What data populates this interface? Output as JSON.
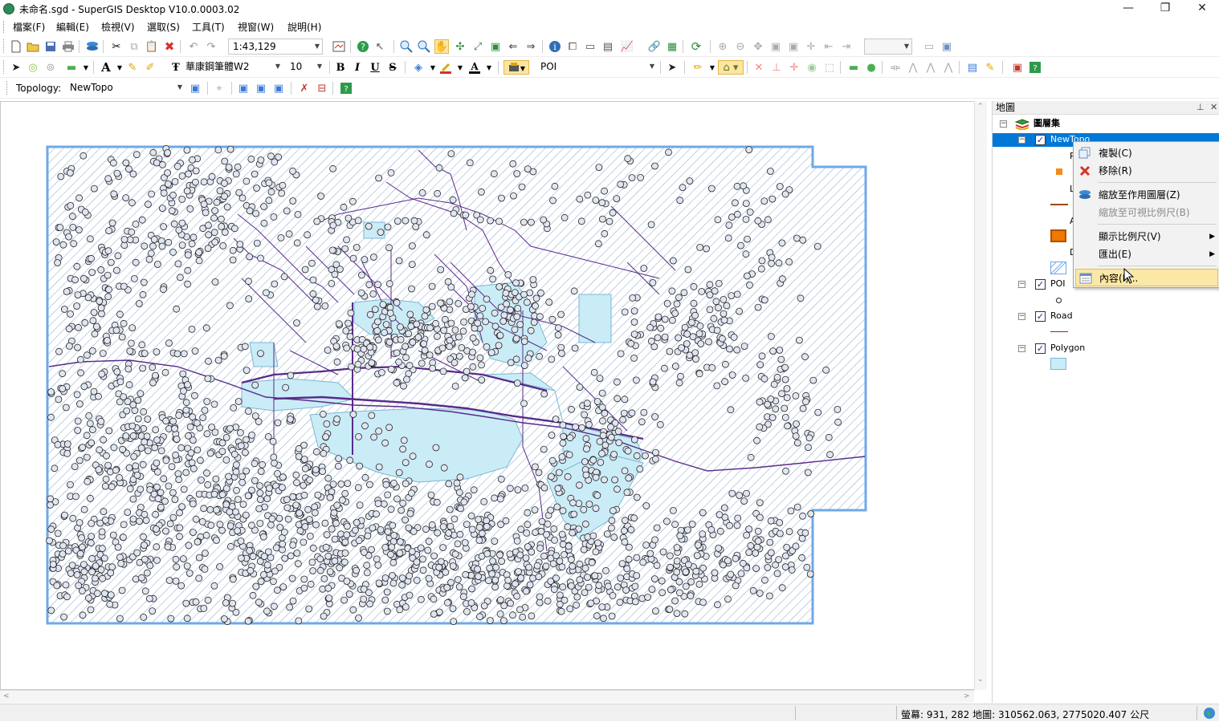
{
  "window": {
    "title": "未命名.sgd - SuperGIS Desktop V10.0.0003.02",
    "minimize": "—",
    "maximize": "❐",
    "close": "✕"
  },
  "menu": [
    "檔案(F)",
    "編輯(E)",
    "檢視(V)",
    "選取(S)",
    "工具(T)",
    "視窗(W)",
    "說明(H)"
  ],
  "toolbar_standard": {
    "scale": "1:43,129",
    "scale_right": ""
  },
  "toolbar_format": {
    "font_name": "華康鋼筆體W2",
    "font_size": "10",
    "bold": "B",
    "italic": "I",
    "underline": "U",
    "strikethrough": "S",
    "target_layer": "POI"
  },
  "toolbar_topology": {
    "label": "Topology:",
    "value": "NewTopo"
  },
  "panel": {
    "title": "地圖",
    "pin": "⊥",
    "close": "✕",
    "root": "圖層集",
    "layers": [
      {
        "name": "NewTopo",
        "checked": true
      },
      {
        "name": "POI",
        "checked": true
      },
      {
        "name": "Road",
        "checked": true
      },
      {
        "name": "Polygon",
        "checked": true
      }
    ],
    "legend_partial_labels": [
      "P",
      "L",
      "A",
      "D"
    ]
  },
  "context_menu": {
    "items": [
      {
        "label": "複製(C)",
        "enabled": true,
        "icon": "copy-icon"
      },
      {
        "label": "移除(R)",
        "enabled": true,
        "icon": "remove-icon"
      },
      {
        "label": "縮放至作用圖層(Z)",
        "enabled": true,
        "icon": "zoom-to-layer-icon"
      },
      {
        "label": "縮放至可視比例尺(B)",
        "enabled": false,
        "icon": ""
      },
      {
        "label": "顯示比例尺(V)",
        "enabled": true,
        "icon": "",
        "submenu": true
      },
      {
        "label": "匯出(E)",
        "enabled": true,
        "icon": "",
        "submenu": true
      },
      {
        "label": "內容(I)...",
        "enabled": true,
        "icon": "properties-icon",
        "hovered": true
      }
    ]
  },
  "status": {
    "coordinates": "螢幕: 931, 282  地圖: 310562.063, 2775020.407 公尺"
  },
  "colors": {
    "extent_outline": "#6fa8e8",
    "hatch": "#8aa7c8",
    "water_fill": "#c9ecf7",
    "road": "#5a2a8a",
    "poi_fill": "#dfe6f2",
    "selection": "#0078d7"
  }
}
